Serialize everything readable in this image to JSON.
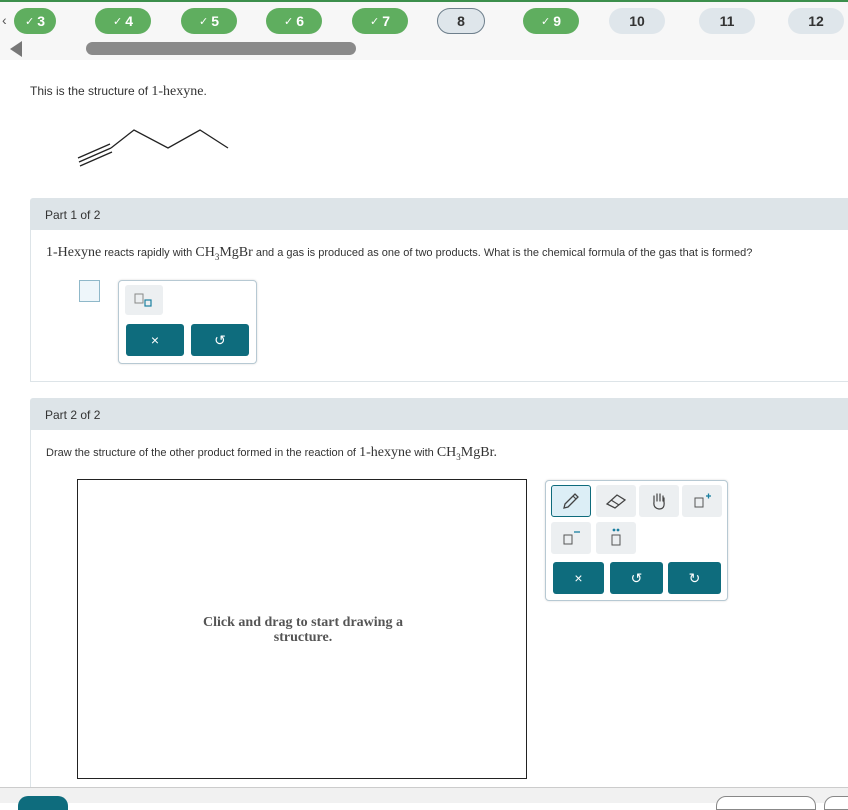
{
  "question_nav": {
    "items": [
      {
        "label": "3",
        "status": "done"
      },
      {
        "label": "4",
        "status": "done"
      },
      {
        "label": "5",
        "status": "done"
      },
      {
        "label": "6",
        "status": "done"
      },
      {
        "label": "7",
        "status": "done"
      },
      {
        "label": "8",
        "status": "current"
      },
      {
        "label": "9",
        "status": "done"
      },
      {
        "label": "10",
        "status": "todo"
      },
      {
        "label": "11",
        "status": "todo"
      },
      {
        "label": "12",
        "status": "todo"
      }
    ],
    "check_glyph": "✓",
    "prev_glyph": "‹"
  },
  "intro": {
    "prefix": "This is the structure of ",
    "compound": "1-hexyne",
    "suffix": "."
  },
  "part1": {
    "header": "Part 1 of 2",
    "compound": "1-Hexyne",
    "text_a": " reacts rapidly with ",
    "reagent_main": "CH",
    "reagent_sub": "3",
    "reagent_tail": "MgBr",
    "text_b": " and a gas is produced as one of two products. What is the chemical formula of the gas that is formed?",
    "clear_glyph": "×",
    "undo_glyph": "↺"
  },
  "part2": {
    "header": "Part 2 of 2",
    "text_a": "Draw the structure of the other product formed in the reaction of ",
    "compound": "1-hexyne",
    "text_b": " with ",
    "reagent_main": "CH",
    "reagent_sub": "3",
    "reagent_tail": "MgBr.",
    "canvas_hint_line1": "Click and drag to start drawing a",
    "canvas_hint_line2": "structure.",
    "clear_glyph": "×",
    "undo_glyph": "↺",
    "redo_glyph": "↻"
  },
  "colors": {
    "done": "#5fae5f",
    "accent": "#0e6c7d",
    "part_header_bg": "#dde4e8"
  }
}
